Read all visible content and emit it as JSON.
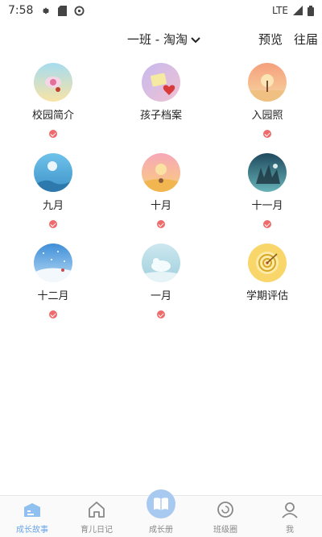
{
  "status_bar": {
    "time": "7:58",
    "network": "LTE"
  },
  "header": {
    "class_name": "一班 - 淘淘",
    "preview": "预览",
    "past": "往届"
  },
  "items": [
    {
      "label": "校园简介",
      "icon": "school-intro-icon",
      "checked": true
    },
    {
      "label": "孩子档案",
      "icon": "child-profile-icon",
      "checked": false
    },
    {
      "label": "入园照",
      "icon": "entrance-photo-icon",
      "checked": true
    },
    {
      "label": "九月",
      "icon": "september-icon",
      "checked": true
    },
    {
      "label": "十月",
      "icon": "october-icon",
      "checked": true
    },
    {
      "label": "十一月",
      "icon": "november-icon",
      "checked": true
    },
    {
      "label": "十二月",
      "icon": "december-icon",
      "checked": true
    },
    {
      "label": "一月",
      "icon": "january-icon",
      "checked": true
    },
    {
      "label": "学期评估",
      "icon": "evaluation-icon",
      "checked": false
    }
  ],
  "nav": [
    {
      "label": "成长故事",
      "active": true
    },
    {
      "label": "育儿日记",
      "active": false
    },
    {
      "label": "成长册",
      "active": false
    },
    {
      "label": "班级圈",
      "active": false
    },
    {
      "label": "我",
      "active": false
    }
  ],
  "colors": {
    "accent": "#6aa6e6",
    "check": "#ef6a6a"
  }
}
